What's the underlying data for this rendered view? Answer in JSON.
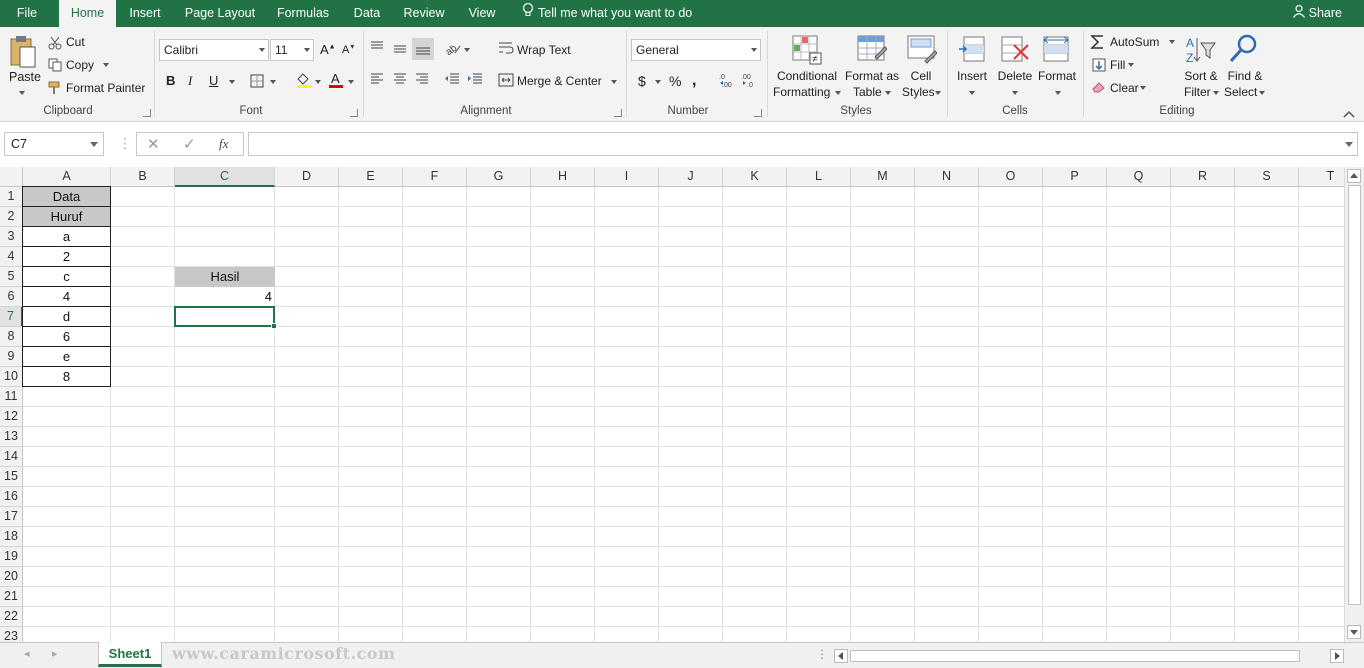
{
  "tabs": [
    {
      "label": "File"
    },
    {
      "label": "Home"
    },
    {
      "label": "Insert"
    },
    {
      "label": "Page Layout"
    },
    {
      "label": "Formulas"
    },
    {
      "label": "Data"
    },
    {
      "label": "Review"
    },
    {
      "label": "View"
    }
  ],
  "active_tab": "Home",
  "tell_me": "Tell me what you want to do",
  "share": "Share",
  "clipboard": {
    "paste": "Paste",
    "cut": "Cut",
    "copy": "Copy",
    "format_painter": "Format Painter",
    "label": "Clipboard"
  },
  "font": {
    "name": "Calibri",
    "size": "11",
    "bold": "B",
    "italic": "I",
    "underline": "U",
    "label": "Font"
  },
  "alignment": {
    "wrap_text": "Wrap Text",
    "merge_center": "Merge & Center",
    "label": "Alignment"
  },
  "number": {
    "format": "General",
    "currency": "$",
    "percent": "%",
    "label": "Number"
  },
  "styles": {
    "conditional1": "Conditional",
    "conditional2": "Formatting",
    "format_table1": "Format as",
    "format_table2": "Table",
    "cell_styles1": "Cell",
    "cell_styles2": "Styles",
    "label": "Styles"
  },
  "cells": {
    "insert": "Insert",
    "delete": "Delete",
    "format": "Format",
    "label": "Cells"
  },
  "editing": {
    "autosum": "AutoSum",
    "fill": "Fill",
    "clear": "Clear",
    "sort1": "Sort &",
    "sort2": "Filter",
    "find1": "Find &",
    "find2": "Select",
    "label": "Editing"
  },
  "name_box": "C7",
  "fx": "fx",
  "columns": [
    "A",
    "B",
    "C",
    "D",
    "E",
    "F",
    "G",
    "H",
    "I",
    "J",
    "K",
    "L",
    "M",
    "N",
    "O",
    "P",
    "Q",
    "R",
    "S",
    "T"
  ],
  "rows": [
    "1",
    "2",
    "3",
    "4",
    "5",
    "6",
    "7",
    "8",
    "9",
    "10",
    "11",
    "12",
    "13",
    "14",
    "15",
    "16",
    "17",
    "18",
    "19",
    "20",
    "21",
    "22",
    "23"
  ],
  "cells_data": {
    "A1": "Data",
    "A2": "Huruf",
    "A3": "a",
    "A4": "2",
    "A5": "c",
    "A6": "4",
    "A7": "d",
    "A8": "6",
    "A9": "e",
    "A10": "8",
    "C5": "Hasil",
    "C6": "4"
  },
  "sheet_tab": "Sheet1",
  "watermark": "www.caramicrosoft.com",
  "colors": {
    "accent": "#217346",
    "header_fill": "#c8c8c8"
  }
}
